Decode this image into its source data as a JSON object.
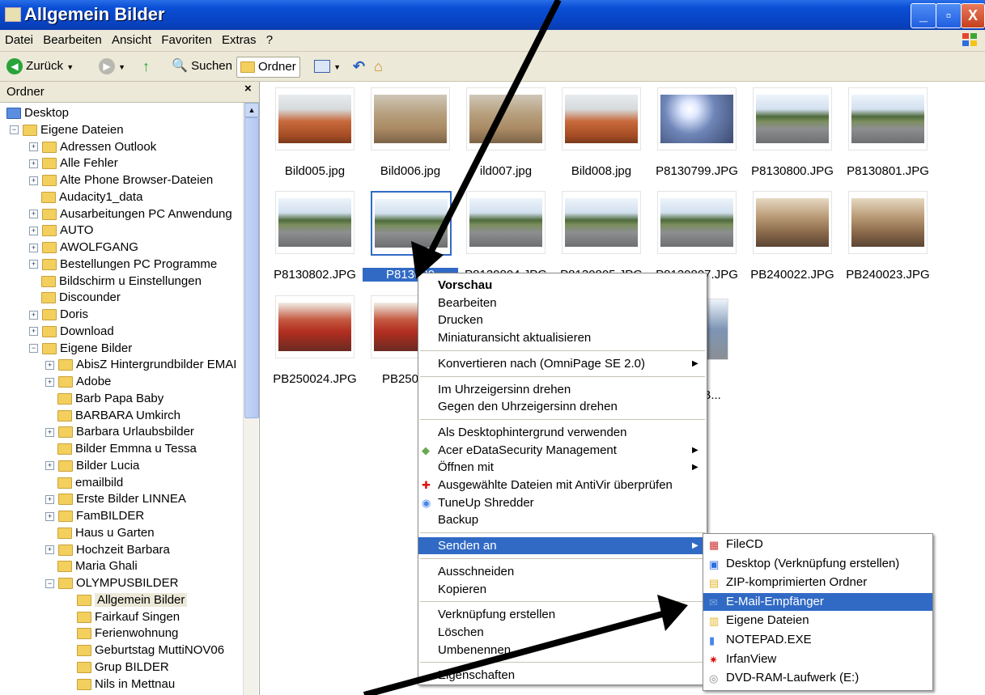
{
  "window": {
    "title": "Allgemein Bilder",
    "btn_min": "_",
    "btn_max": "▫",
    "btn_close": "X"
  },
  "menubar": [
    "Datei",
    "Bearbeiten",
    "Ansicht",
    "Favoriten",
    "Extras",
    "?"
  ],
  "toolbar": {
    "back": "Zurück",
    "search": "Suchen",
    "folders": "Ordner"
  },
  "sidebar": {
    "header": "Ordner",
    "close": "×",
    "tree": [
      {
        "label": "Desktop",
        "indent": 0,
        "pm": ""
      },
      {
        "label": "Eigene Dateien",
        "indent": 1,
        "pm": "-"
      },
      {
        "label": "Adressen Outlook",
        "indent": 2,
        "pm": "+"
      },
      {
        "label": "Alle Fehler",
        "indent": 2,
        "pm": "+"
      },
      {
        "label": "Alte Phone Browser-Dateien",
        "indent": 2,
        "pm": "+"
      },
      {
        "label": "Audacity1_data",
        "indent": 2,
        "pm": ""
      },
      {
        "label": "Ausarbeitungen PC Anwendung",
        "indent": 2,
        "pm": "+"
      },
      {
        "label": "AUTO",
        "indent": 2,
        "pm": "+"
      },
      {
        "label": "AWOLFGANG",
        "indent": 2,
        "pm": "+"
      },
      {
        "label": "Bestellungen PC Programme",
        "indent": 2,
        "pm": "+"
      },
      {
        "label": "Bildschirm u Einstellungen",
        "indent": 2,
        "pm": ""
      },
      {
        "label": "Discounder",
        "indent": 2,
        "pm": ""
      },
      {
        "label": "Doris",
        "indent": 2,
        "pm": "+"
      },
      {
        "label": "Download",
        "indent": 2,
        "pm": "+"
      },
      {
        "label": "Eigene Bilder",
        "indent": 2,
        "pm": "-"
      },
      {
        "label": "AbisZ Hintergrundbilder  EMAI",
        "indent": 3,
        "pm": "+"
      },
      {
        "label": "Adobe",
        "indent": 3,
        "pm": "+"
      },
      {
        "label": "Barb Papa Baby",
        "indent": 3,
        "pm": ""
      },
      {
        "label": "BARBARA Umkirch",
        "indent": 3,
        "pm": ""
      },
      {
        "label": "Barbara Urlaubsbilder",
        "indent": 3,
        "pm": "+"
      },
      {
        "label": "Bilder Emmna u Tessa",
        "indent": 3,
        "pm": ""
      },
      {
        "label": "Bilder Lucia",
        "indent": 3,
        "pm": "+"
      },
      {
        "label": "emailbild",
        "indent": 3,
        "pm": ""
      },
      {
        "label": "Erste Bilder LINNEA",
        "indent": 3,
        "pm": "+"
      },
      {
        "label": "FamBILDER",
        "indent": 3,
        "pm": "+"
      },
      {
        "label": "Haus u Garten",
        "indent": 3,
        "pm": ""
      },
      {
        "label": "Hochzeit Barbara",
        "indent": 3,
        "pm": "+"
      },
      {
        "label": "Maria Ghali",
        "indent": 3,
        "pm": ""
      },
      {
        "label": "OLYMPUSBILDER",
        "indent": 3,
        "pm": "-"
      },
      {
        "label": "Allgemein Bilder",
        "indent": 4,
        "pm": "",
        "selected": true
      },
      {
        "label": "Fairkauf Singen",
        "indent": 4,
        "pm": ""
      },
      {
        "label": "Ferienwohnung",
        "indent": 4,
        "pm": ""
      },
      {
        "label": "Geburtstag MuttiNOV06",
        "indent": 4,
        "pm": ""
      },
      {
        "label": "Grup BILDER",
        "indent": 4,
        "pm": ""
      },
      {
        "label": "Nils in Mettnau",
        "indent": 4,
        "pm": ""
      }
    ]
  },
  "files": [
    {
      "name": "Bild005.jpg",
      "kind": "sofa"
    },
    {
      "name": "Bild006.jpg",
      "kind": "chair"
    },
    {
      "name": "ild007.jpg",
      "kind": "chair"
    },
    {
      "name": "Bild008.jpg",
      "kind": "sofa"
    },
    {
      "name": "P8130799.JPG",
      "kind": "sun"
    },
    {
      "name": "P8130800.JPG",
      "kind": "street"
    },
    {
      "name": "P8130801.JPG",
      "kind": "street"
    },
    {
      "name": "P8130802.JPG",
      "kind": "street"
    },
    {
      "name": "P813080",
      "kind": "street",
      "selected": true
    },
    {
      "name": "P8130804.JPG",
      "kind": "street"
    },
    {
      "name": "P8130805.JPG",
      "kind": "street"
    },
    {
      "name": "P8130807.JPG",
      "kind": "street"
    },
    {
      "name": "PB240022.JPG",
      "kind": "room"
    },
    {
      "name": "PB240023.JPG",
      "kind": "room"
    },
    {
      "name": "PB250024.JPG",
      "kind": "shop"
    },
    {
      "name": "PB250025",
      "kind": "shop"
    }
  ],
  "partial_labels": {
    "line1": "n",
    "line2": "t B..."
  },
  "context_menu": [
    {
      "label": "Vorschau",
      "bold": true
    },
    {
      "label": "Bearbeiten"
    },
    {
      "label": "Drucken"
    },
    {
      "label": "Miniaturansicht aktualisieren"
    },
    {
      "sep": true
    },
    {
      "label": "Konvertieren nach (OmniPage SE 2.0)",
      "sub": true
    },
    {
      "sep": true
    },
    {
      "label": "Im Uhrzeigersinn drehen"
    },
    {
      "label": "Gegen den Uhrzeigersinn drehen"
    },
    {
      "sep": true
    },
    {
      "label": "Als Desktophintergrund verwenden"
    },
    {
      "label": "Acer eDataSecurity Management",
      "sub": true,
      "icon": "acer"
    },
    {
      "label": "Öffnen mit",
      "sub": true
    },
    {
      "label": "Ausgewählte Dateien mit AntiVir überprüfen",
      "icon": "antivir"
    },
    {
      "label": "TuneUp Shredder",
      "icon": "tuneup"
    },
    {
      "label": "Backup"
    },
    {
      "sep": true
    },
    {
      "label": "Senden an",
      "sub": true,
      "highlight": true
    },
    {
      "sep": true
    },
    {
      "label": "Ausschneiden"
    },
    {
      "label": "Kopieren"
    },
    {
      "sep": true
    },
    {
      "label": "Verknüpfung erstellen"
    },
    {
      "label": "Löschen"
    },
    {
      "label": "Umbenennen"
    },
    {
      "sep": true
    },
    {
      "label": "Eigenschaften"
    }
  ],
  "send_to": [
    {
      "label": "FileCD",
      "icon": "filecd"
    },
    {
      "label": "Desktop (Verknüpfung erstellen)",
      "icon": "desktop"
    },
    {
      "label": "ZIP-komprimierten Ordner",
      "icon": "zip"
    },
    {
      "label": "E-Mail-Empfänger",
      "icon": "mail",
      "highlight": true
    },
    {
      "label": "Eigene Dateien",
      "icon": "docs"
    },
    {
      "label": "NOTEPAD.EXE",
      "icon": "notepad"
    },
    {
      "label": "IrfanView",
      "icon": "irfan"
    },
    {
      "label": "DVD-RAM-Laufwerk (E:)",
      "icon": "dvd"
    }
  ]
}
